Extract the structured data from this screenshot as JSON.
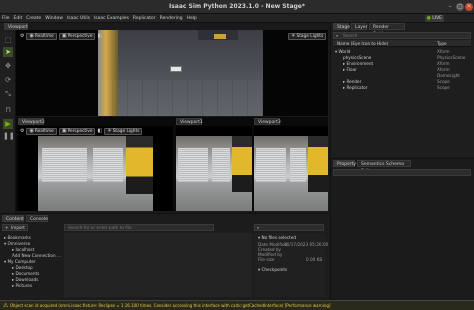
{
  "window": {
    "title": "Isaac Sim Python 2023.1.0 - New Stage*"
  },
  "menu": [
    "File",
    "Edit",
    "Create",
    "Window",
    "Isaac Utils",
    "Isaac Examples",
    "Replicator",
    "Rendering",
    "Help"
  ],
  "live": {
    "label": "LIVE"
  },
  "viewports": {
    "top": {
      "tab": "Viewport",
      "resolution": "Realtime",
      "camera": "Perspective",
      "lights": "Stage Lights"
    },
    "v2": {
      "tab": "Viewport2",
      "resolution": "Realtime",
      "camera": "Perspective",
      "lights": "Stage Lights"
    },
    "v1": {
      "tab": "Viewport1"
    },
    "v3": {
      "tab": "Viewport3"
    }
  },
  "stage": {
    "tabs": [
      "Stage",
      "Layer",
      "Render Settings"
    ],
    "search_placeholder": "Search",
    "col_name": "Name (Eye Icon to Hide)",
    "col_type": "Type",
    "items": [
      {
        "name": "World",
        "type": "Xform"
      },
      {
        "name": "physicsScene",
        "type": "PhysicsScene"
      },
      {
        "name": "Environment",
        "type": "Xform"
      },
      {
        "name": "Floor",
        "type": "Xform"
      },
      {
        "name": "Render",
        "type": "Scope"
      },
      {
        "name": "Replicator",
        "type": "Scope"
      }
    ],
    "extra_types": [
      "DomeLight",
      "Scope"
    ]
  },
  "property": {
    "tabs": [
      "Property",
      "Semantics Schema Editor"
    ]
  },
  "content": {
    "tabs": [
      "Content",
      "Console"
    ],
    "import_label": "Import",
    "path_placeholder": "Search for or enter path to file",
    "tree": [
      "Bookmarks",
      "Omniverse",
      "localhost",
      "Add New Connection ...",
      "My Computer",
      "Desktop",
      "Documents",
      "Downloads",
      "Pictures"
    ],
    "no_selection": "No files selected",
    "info": [
      {
        "k": "Date Modified",
        "v": "10/17/2023 05:26:00 PM"
      },
      {
        "k": "Created by",
        "v": ""
      },
      {
        "k": "Modified by",
        "v": ""
      },
      {
        "k": "File size",
        "v": "0.00 KB"
      }
    ],
    "checkpoints": "Checkpoints"
  },
  "status": {
    "text": "Object scan id acquired (omni.isaac.fixture: Reclipse = 1.16.100 times. Consider accessing this interface with carb::getCachedInterface) [Performance warning]"
  }
}
